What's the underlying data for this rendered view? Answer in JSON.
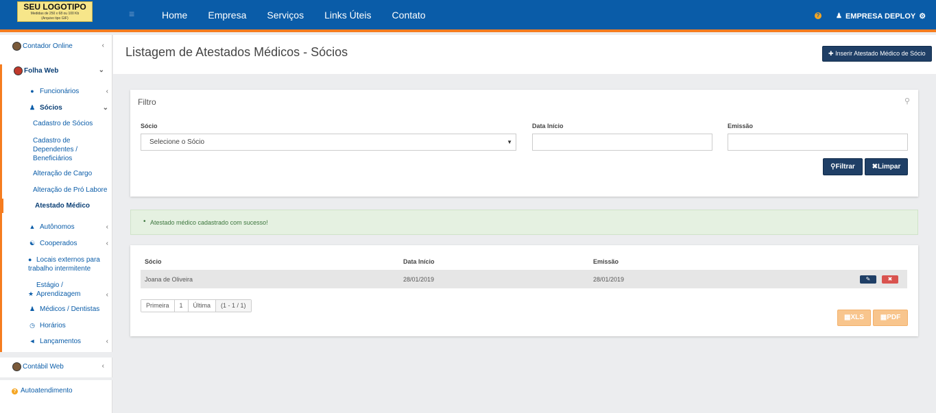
{
  "logo": {
    "title": "SEU LOGOTIPO",
    "line2": "Medidas de 250 x 68 ou 100 Kb",
    "line3": "(Arquivo tipo GIF)"
  },
  "nav": {
    "menu_icon": "hamburger-icon",
    "items": [
      "Home",
      "Empresa",
      "Serviços",
      "Links Úteis",
      "Contato"
    ]
  },
  "user": {
    "name": "EMPRESA DEPLOY",
    "help_icon": "?",
    "user_icon": "user-icon",
    "gear_icon": "gear-icon"
  },
  "sidebar": {
    "contador": "Contador Online",
    "folha": "Folha Web",
    "funcionarios": "Funcionários",
    "socios": "Sócios",
    "sub": [
      "Cadastro de Sócios",
      "Cadastro de Dependentes / Beneficiários",
      "Alteração de Cargo",
      "Alteração de Pró Labore",
      "Atestado Médico"
    ],
    "autonomos": "Autônomos",
    "cooperados": "Cooperados",
    "locais": "Locais externos para trabalho intermitente",
    "estagio": "Estágio / Aprendizagem",
    "medicos": "Médicos / Dentistas",
    "horarios": "Horários",
    "lancamentos": "Lançamentos",
    "contabil": "Contábil Web",
    "autoatendimento": "Autoatendimento"
  },
  "page": {
    "title": "Listagem de Atestados Médicos - Sócios",
    "insert_button": "Inserir Atestado Médico de Sócio"
  },
  "filter": {
    "title": "Filtro",
    "socio_label": "Sócio",
    "socio_placeholder": "Selecione o Sócio",
    "data_inicio_label": "Data Início",
    "data_inicio_value": "",
    "emissao_label": "Emissão",
    "emissao_value": "",
    "filter_button": "Filtrar",
    "clear_button": "Limpar"
  },
  "alert": {
    "message": "Atestado médico cadastrado com sucesso!"
  },
  "table": {
    "headers": [
      "Sócio",
      "Data Início",
      "Emissão"
    ],
    "rows": [
      {
        "socio": "Joana de Oliveira",
        "data_inicio": "28/01/2019",
        "emissao": "28/01/2019"
      }
    ]
  },
  "pager": {
    "first": "Primeira",
    "page": "1",
    "last": "Última",
    "info": "(1 - 1 / 1)"
  },
  "export": {
    "xls": "XLS",
    "pdf": "PDF"
  },
  "colors": {
    "primary": "#0a5ca8",
    "accent": "#f57c1f",
    "dark_button": "#1f3f66",
    "success_bg": "#e5f1e1",
    "export_button": "#f8c58d"
  }
}
